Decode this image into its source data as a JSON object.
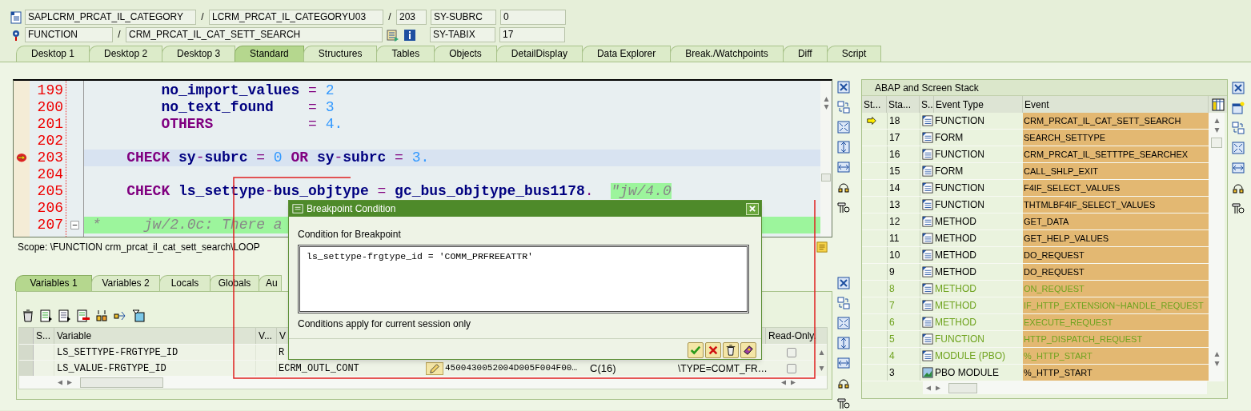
{
  "header": {
    "program": "SAPLCRM_PRCAT_IL_CATEGORY",
    "include": "LCRM_PRCAT_IL_CATEGORYU03",
    "line": "203",
    "event_type": "FUNCTION",
    "event": "CRM_PRCAT_IL_CAT_SETT_SEARCH",
    "separators": [
      "/",
      "/",
      "/"
    ],
    "sysfields": [
      {
        "name": "SY-SUBRC",
        "value": "0"
      },
      {
        "name": "SY-TABIX",
        "value": "17"
      }
    ]
  },
  "tabs": [
    {
      "label": "Desktop 1",
      "selected": false
    },
    {
      "label": "Desktop 2",
      "selected": false
    },
    {
      "label": "Desktop 3",
      "selected": false
    },
    {
      "label": "Standard",
      "selected": true
    },
    {
      "label": "Structures",
      "selected": false
    },
    {
      "label": "Tables",
      "selected": false
    },
    {
      "label": "Objects",
      "selected": false
    },
    {
      "label": "DetailDisplay",
      "selected": false
    },
    {
      "label": "Data Explorer",
      "selected": false
    },
    {
      "label": "Break./Watchpoints",
      "selected": false
    },
    {
      "label": "Diff",
      "selected": false
    },
    {
      "label": "Script",
      "selected": false
    }
  ],
  "code": {
    "lines": [
      {
        "number": "199",
        "current": false,
        "breakpoint": false,
        "fold": false,
        "tokens": [
          {
            "kind": "id",
            "text": "        no_import_values"
          },
          {
            "kind": "op",
            "text": " = "
          },
          {
            "kind": "num",
            "text": "2"
          }
        ]
      },
      {
        "number": "200",
        "current": false,
        "breakpoint": false,
        "fold": false,
        "tokens": [
          {
            "kind": "id",
            "text": "        no_text_found"
          },
          {
            "kind": "op",
            "text": "    = "
          },
          {
            "kind": "num",
            "text": "3"
          }
        ]
      },
      {
        "number": "201",
        "current": false,
        "breakpoint": false,
        "fold": false,
        "tokens": [
          {
            "kind": "kw",
            "text": "        OTHERS"
          },
          {
            "kind": "op",
            "text": "           = "
          },
          {
            "kind": "num",
            "text": "4."
          }
        ]
      },
      {
        "number": "202",
        "current": false,
        "breakpoint": false,
        "fold": false
      },
      {
        "number": "203",
        "current": true,
        "breakpoint": true,
        "fold": false,
        "tokens": [
          {
            "kind": "kw",
            "text": "    CHECK"
          },
          {
            "kind": "id",
            "text": " sy"
          },
          {
            "kind": "op",
            "text": "-"
          },
          {
            "kind": "id",
            "text": "subrc"
          },
          {
            "kind": "op",
            "text": " = "
          },
          {
            "kind": "num",
            "text": "0"
          },
          {
            "kind": "kw",
            "text": " OR"
          },
          {
            "kind": "id",
            "text": " sy"
          },
          {
            "kind": "op",
            "text": "-"
          },
          {
            "kind": "id",
            "text": "subrc"
          },
          {
            "kind": "op",
            "text": " = "
          },
          {
            "kind": "num",
            "text": "3."
          }
        ]
      },
      {
        "number": "204",
        "current": false,
        "breakpoint": false,
        "fold": false
      },
      {
        "number": "205",
        "current": false,
        "breakpoint": false,
        "fold": false,
        "tokens": [
          {
            "kind": "kw",
            "text": "    CHECK"
          },
          {
            "kind": "id",
            "text": " ls_settype"
          },
          {
            "kind": "op",
            "text": "-"
          },
          {
            "kind": "id",
            "text": "bus_objtype"
          },
          {
            "kind": "op",
            "text": " = "
          },
          {
            "kind": "id",
            "text": "gc_bus_objtype_bus1178"
          },
          {
            "kind": "op",
            "text": ".  "
          },
          {
            "kind": "comment",
            "text": "\"jw/4.0"
          }
        ]
      },
      {
        "number": "206",
        "current": false,
        "breakpoint": false,
        "fold": false
      },
      {
        "number": "207",
        "current": false,
        "breakpoint": false,
        "fold": true,
        "tokens": [
          {
            "kind": "comment_line",
            "text": "*     jw/2.0c: There a"
          }
        ]
      }
    ],
    "scope": "Scope: \\FUNCTION crm_prcat_il_cat_sett_search\\LOOP"
  },
  "variable_tabs": [
    {
      "label": "Variables 1",
      "selected": true
    },
    {
      "label": "Variables 2",
      "selected": false
    },
    {
      "label": "Locals",
      "selected": false
    },
    {
      "label": "Globals",
      "selected": false
    },
    {
      "label": "Au",
      "selected": false
    }
  ],
  "variables": {
    "columns": [
      {
        "label": "S..."
      },
      {
        "label": "Variable"
      },
      {
        "label": "V..."
      },
      {
        "label": "V"
      },
      {
        "label": "Read-Only."
      }
    ],
    "rows": [
      {
        "variable": "LS_SETTYPE-FRGTYPE_ID",
        "column_4": "R",
        "read_only": false
      },
      {
        "variable": "LS_VALUE-FRGTYPE_ID",
        "column_4": "ECRM_OUTL_CONT",
        "column_5": "4500430052004D005F004F00…",
        "column_6": "C(16)",
        "column_7": "\\TYPE=COMT_FR…",
        "read_only": false
      }
    ]
  },
  "stack": {
    "title": "ABAP and Screen Stack",
    "columns": [
      {
        "label": "St..."
      },
      {
        "label": "Sta..."
      },
      {
        "label": "S.."
      },
      {
        "label": "Event Type"
      },
      {
        "label": "Event"
      }
    ],
    "rows": [
      {
        "level": "18",
        "current": true,
        "dimmed": false,
        "kind": "program",
        "event_type": "FUNCTION",
        "event": "CRM_PRCAT_IL_CAT_SETT_SEARCH"
      },
      {
        "level": "17",
        "current": false,
        "dimmed": false,
        "kind": "program",
        "event_type": "FORM",
        "event": "SEARCH_SETTYPE"
      },
      {
        "level": "16",
        "current": false,
        "dimmed": false,
        "kind": "program",
        "event_type": "FUNCTION",
        "event": "CRM_PRCAT_IL_SETTTPE_SEARCHEX"
      },
      {
        "level": "15",
        "current": false,
        "dimmed": false,
        "kind": "program",
        "event_type": "FORM",
        "event": "CALL_SHLP_EXIT"
      },
      {
        "level": "14",
        "current": false,
        "dimmed": false,
        "kind": "program",
        "event_type": "FUNCTION",
        "event": "F4IF_SELECT_VALUES"
      },
      {
        "level": "13",
        "current": false,
        "dimmed": false,
        "kind": "program",
        "event_type": "FUNCTION",
        "event": "THTMLBF4IF_SELECT_VALUES"
      },
      {
        "level": "12",
        "current": false,
        "dimmed": false,
        "kind": "program",
        "event_type": "METHOD",
        "event": "GET_DATA"
      },
      {
        "level": "11",
        "current": false,
        "dimmed": false,
        "kind": "program",
        "event_type": "METHOD",
        "event": "GET_HELP_VALUES"
      },
      {
        "level": "10",
        "current": false,
        "dimmed": false,
        "kind": "program",
        "event_type": "METHOD",
        "event": "DO_REQUEST"
      },
      {
        "level": "9",
        "current": false,
        "dimmed": false,
        "kind": "program",
        "event_type": "METHOD",
        "event": "DO_REQUEST"
      },
      {
        "level": "8",
        "current": false,
        "dimmed": true,
        "kind": "program",
        "event_type": "METHOD",
        "event": "ON_REQUEST"
      },
      {
        "level": "7",
        "current": false,
        "dimmed": true,
        "kind": "program",
        "event_type": "METHOD",
        "event": "IF_HTTP_EXTENSION~HANDLE_REQUEST"
      },
      {
        "level": "6",
        "current": false,
        "dimmed": true,
        "kind": "program",
        "event_type": "METHOD",
        "event": "EXECUTE_REQUEST"
      },
      {
        "level": "5",
        "current": false,
        "dimmed": true,
        "kind": "program",
        "event_type": "FUNCTION",
        "event": "HTTP_DISPATCH_REQUEST"
      },
      {
        "level": "4",
        "current": false,
        "dimmed": true,
        "kind": "program",
        "event_type": "MODULE (PBO)",
        "event": "%_HTTP_START"
      },
      {
        "level": "3",
        "current": false,
        "dimmed": false,
        "kind": "screen",
        "event_type": "PBO MODULE",
        "event": "%_HTTP_START"
      }
    ]
  },
  "dialog": {
    "title": "Breakpoint Condition",
    "label": "Condition for Breakpoint",
    "condition": "ls_settype-frgtype_id = 'COMM_PRFREEATTR'",
    "note": "Conditions apply for current session only"
  }
}
